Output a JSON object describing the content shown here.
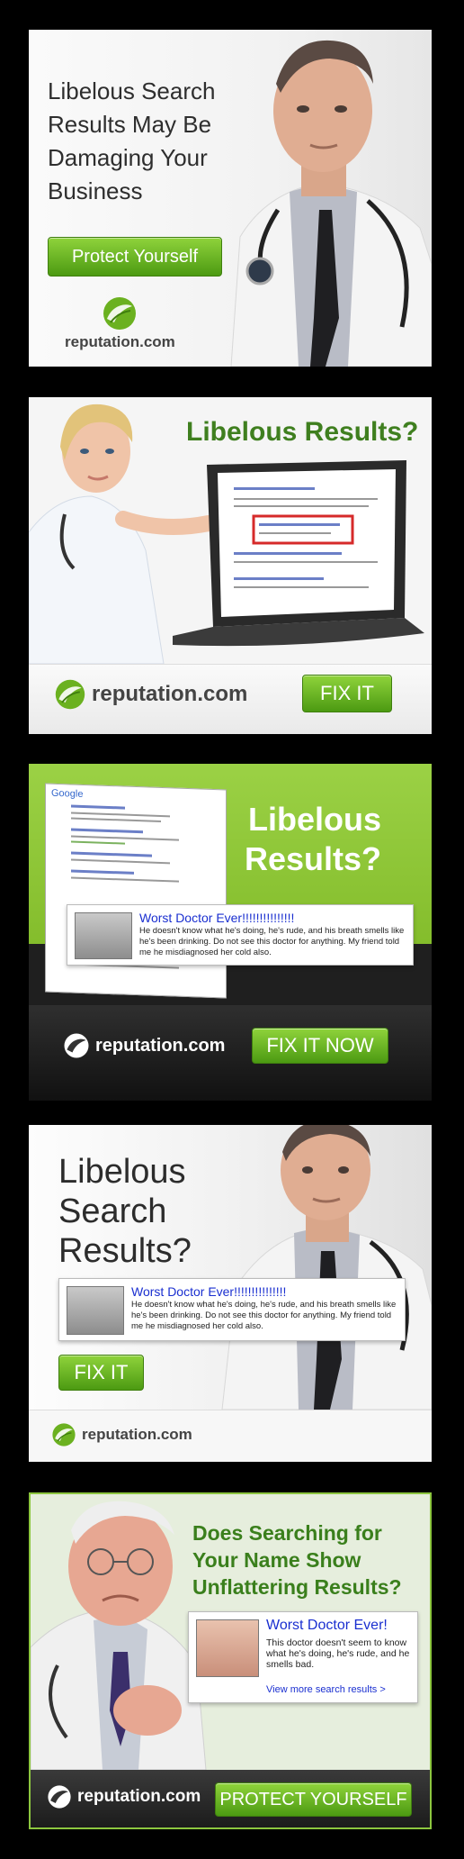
{
  "brand": {
    "logo_text": "reputation.com",
    "green": "#6bb120",
    "dark_green": "#3a7f1c",
    "logo_mark_icon": "reputation-leaf-icon"
  },
  "ad1": {
    "headline": "Libelous Search Results May Be Damaging Your Business",
    "button": "Protect Yourself",
    "logo": "reputation.com"
  },
  "ad2": {
    "headline": "Libelous Results?",
    "button": "FIX IT",
    "logo": "reputation.com"
  },
  "ad3": {
    "headline_line1": "Libelous",
    "headline_line2": "Results?",
    "screen_brand": "Google",
    "review": {
      "title": "Worst Doctor Ever!!!!!!!!!!!!!!!",
      "body": "He doesn't know what he's doing, he's rude, and his breath smells like he's been drinking. Do not see this doctor for anything. My friend told me he misdiagnosed her cold also."
    },
    "button": "FIX IT NOW",
    "logo": "reputation.com"
  },
  "ad4": {
    "headline": "Libelous Search Results?",
    "review": {
      "title": "Worst Doctor Ever!!!!!!!!!!!!!!!",
      "body": "He doesn't know what he's doing, he's rude, and his breath smells like he's been drinking. Do not see this doctor for anything. My friend told me he misdiagnosed her cold also."
    },
    "button": "FIX IT",
    "logo": "reputation.com"
  },
  "ad5": {
    "headline": "Does Searching for Your Name Show Unflattering Results?",
    "review": {
      "title": "Worst Doctor Ever!",
      "body": "This doctor doesn't seem to know what he's doing, he's rude, and he smells bad.",
      "link": "View more search results >"
    },
    "button": "PROTECT YOURSELF",
    "logo": "reputation.com"
  }
}
